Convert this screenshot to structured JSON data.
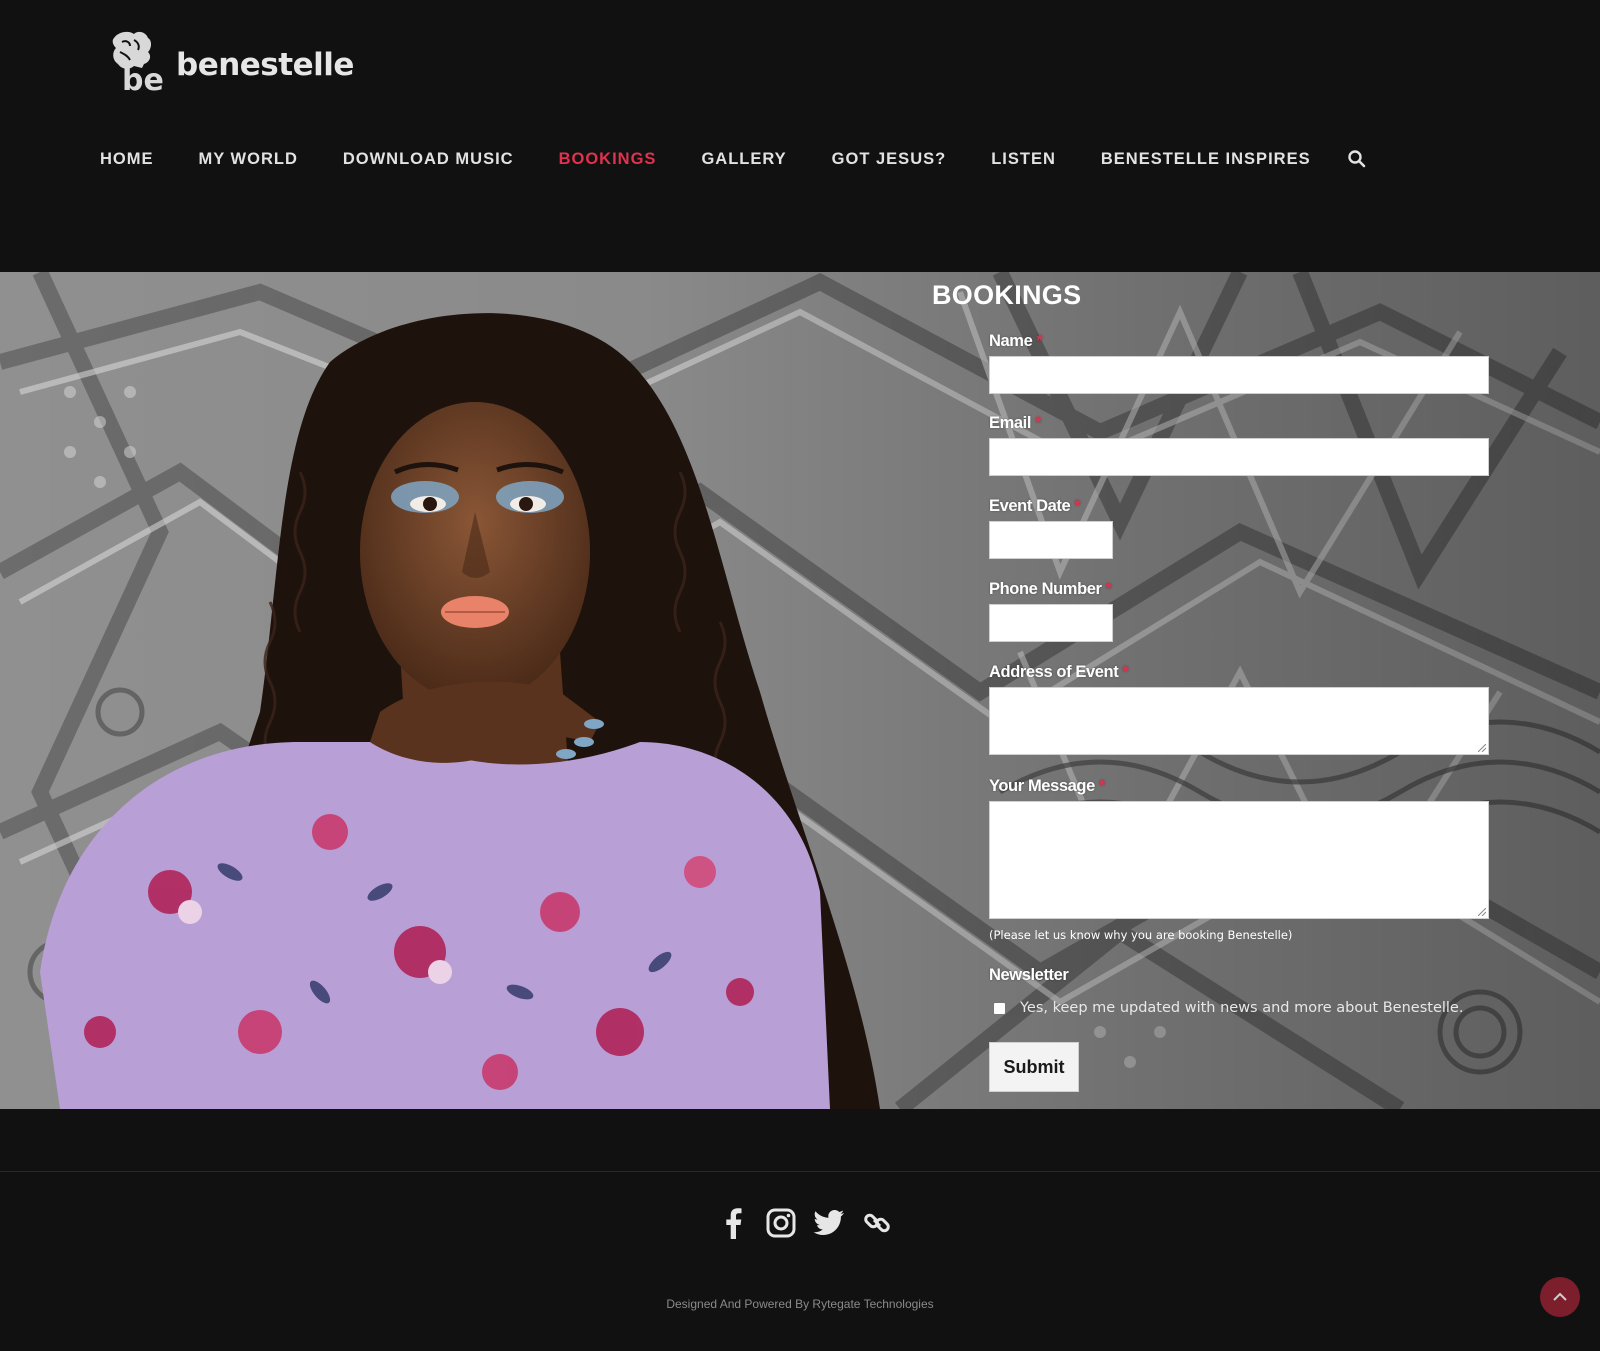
{
  "brand": {
    "name": "benestelle",
    "accent_color": "#e0324e"
  },
  "nav": {
    "items": [
      {
        "label": "HOME",
        "active": false
      },
      {
        "label": "MY WORLD",
        "active": false
      },
      {
        "label": "DOWNLOAD MUSIC",
        "active": false
      },
      {
        "label": "BOOKINGS",
        "active": true
      },
      {
        "label": "GALLERY",
        "active": false
      },
      {
        "label": "GOT JESUS?",
        "active": false
      },
      {
        "label": "LISTEN",
        "active": false
      },
      {
        "label": "BENESTELLE INSPIRES",
        "active": false
      }
    ],
    "search_icon": "search-icon"
  },
  "form": {
    "title": "BOOKINGS",
    "required_mark": "*",
    "fields": {
      "name": {
        "label": "Name",
        "value": ""
      },
      "email": {
        "label": "Email",
        "value": ""
      },
      "event_date": {
        "label": "Event Date",
        "value": ""
      },
      "phone": {
        "label": "Phone Number",
        "value": ""
      },
      "address": {
        "label": "Address of Event",
        "value": ""
      },
      "message": {
        "label": "Your Message",
        "value": "",
        "help": "(Please let us know why you are booking Benestelle)"
      }
    },
    "newsletter": {
      "label": "Newsletter",
      "checkbox_text": "Yes, keep me updated with news and more about Benestelle.",
      "checked": false
    },
    "submit_label": "Submit"
  },
  "footer": {
    "social_icons": [
      "facebook-icon",
      "instagram-icon",
      "twitter-icon",
      "link-icon"
    ],
    "credit": "Designed And Powered By Rytegate Technologies",
    "back_to_top_icon": "chevron-up-icon"
  }
}
